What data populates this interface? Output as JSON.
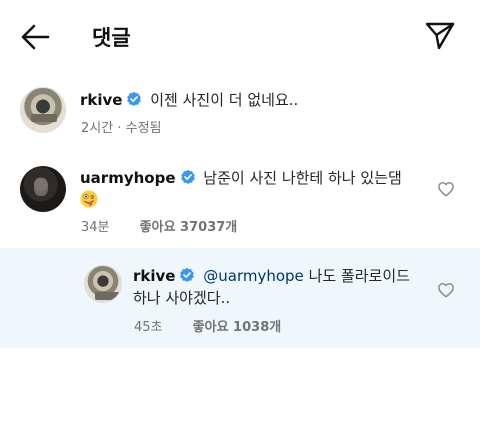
{
  "header": {
    "title": "댓글",
    "back_icon": "arrow-left-icon",
    "send_icon": "paper-plane-icon"
  },
  "caption": {
    "username": "rkive",
    "text": "이젠 사진이 더 없네요..",
    "time": "2시간",
    "separator": "·",
    "edited": "수정됨"
  },
  "comments": [
    {
      "username": "uarmyhope",
      "text": "남준이 사진 나한테 하나 있는댐",
      "emoji": "zany-face-emoji",
      "time": "34분",
      "likes_label": "좋아요 37037개"
    }
  ],
  "reply": {
    "username": "rkive",
    "mention": "@uarmyhope",
    "text_line1": "나도 폴라로이드",
    "text_line2": "하나 사야겠다..",
    "time": "45초",
    "likes_label": "좋아요 1038개"
  },
  "colors": {
    "verified": "#3897f0",
    "mention": "#00376b",
    "reply_highlight": "#eff7fd",
    "meta": "#737373"
  }
}
